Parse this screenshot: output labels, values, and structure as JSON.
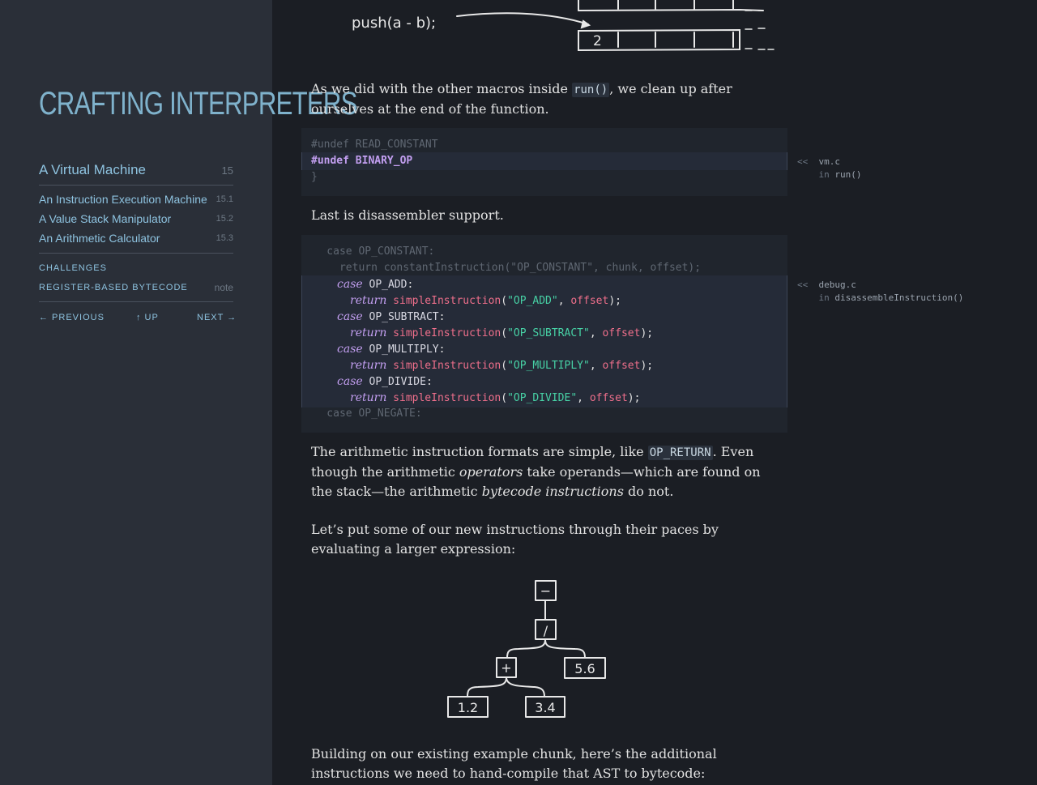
{
  "sidebar": {
    "logo": "CRAFTING INTERPRETERS",
    "chapter": {
      "title": "A Virtual Machine",
      "number": "15"
    },
    "sections": [
      {
        "title": "An Instruction Execution Machine",
        "number": "15.1"
      },
      {
        "title": "A Value Stack Manipulator",
        "number": "15.2"
      },
      {
        "title": "An Arithmetic Calculator",
        "number": "15.3"
      }
    ],
    "challenges": "CHALLENGES",
    "register": "REGISTER-BASED BYTECODE",
    "note": "note",
    "nav": {
      "previous": "← PREVIOUS",
      "up": "↑ UP",
      "next": "NEXT →"
    }
  },
  "top_diagram": {
    "code": "push(a - b);",
    "cell": "2"
  },
  "para1": {
    "before": "As we did with the other macros inside ",
    "code": "run()",
    "after": ", we clean up after ourselves at the end of the function."
  },
  "code1": {
    "lines": [
      "#undef READ_CONSTANT",
      "#undef BINARY_OP",
      "}"
    ],
    "margin_file": "vm.c",
    "margin_in": "in",
    "margin_fn": "run()"
  },
  "para2": "Last is disassembler support.",
  "code2": {
    "context_before": [
      "    case OP_CONSTANT:",
      "      return constantInstruction(\"OP_CONSTANT\", chunk, offset);"
    ],
    "case_kw": "case",
    "return_kw": "return",
    "fn": "simpleInstruction",
    "param": "offset",
    "cases": [
      {
        "op": "OP_ADD",
        "str": "\"OP_ADD\""
      },
      {
        "op": "OP_SUBTRACT",
        "str": "\"OP_SUBTRACT\""
      },
      {
        "op": "OP_MULTIPLY",
        "str": "\"OP_MULTIPLY\""
      },
      {
        "op": "OP_DIVIDE",
        "str": "\"OP_DIVIDE\""
      }
    ],
    "context_after": "    case OP_NEGATE:",
    "margin_file": "debug.c",
    "margin_in": "in",
    "margin_fn": "disassembleInstruction()"
  },
  "para3": {
    "a": "The arithmetic instruction formats are simple, like ",
    "code": "OP_RETURN",
    "b": ". Even though the arithmetic ",
    "em1": "operators",
    "c": " take operands—which are found on the stack—the arithmetic ",
    "em2": "bytecode instructions",
    "d": " do not."
  },
  "para4": "Let’s put some of our new instructions through their paces by evaluating a larger expression:",
  "tree": {
    "root": "−",
    "div": "/",
    "plus": "+",
    "b": "5.6",
    "l1": "1.2",
    "l2": "3.4"
  },
  "para5": "Building on our existing example chunk, here’s the additional instructions we need to hand-compile that AST to bytecode:"
}
